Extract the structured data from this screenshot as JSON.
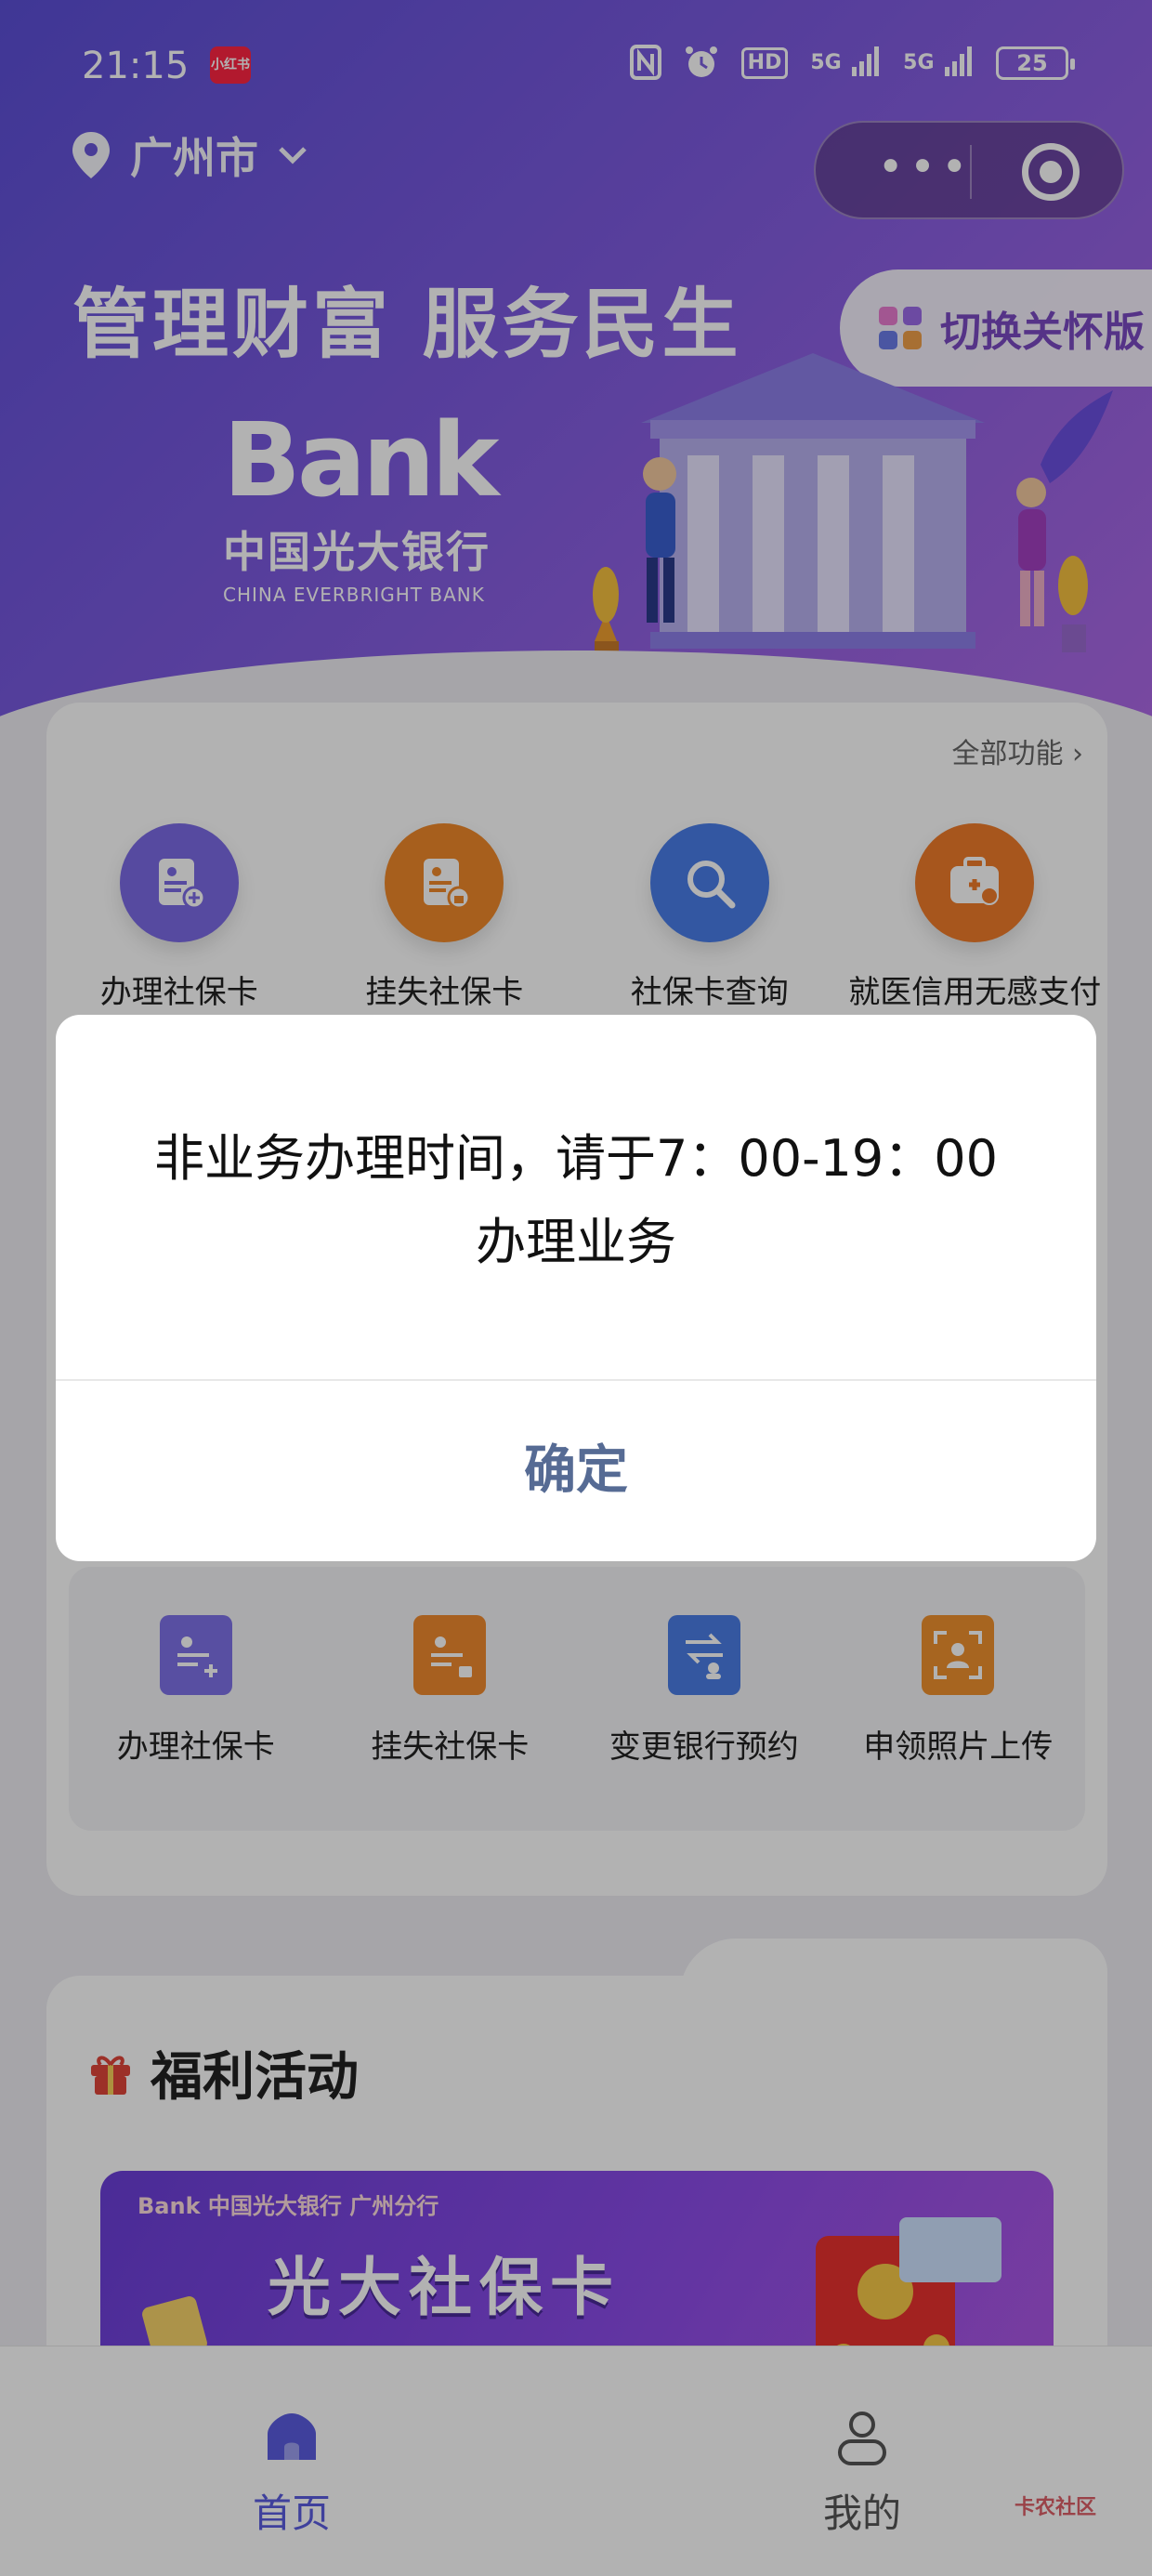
{
  "status_bar": {
    "time": "21:15",
    "app_badge": "小红书",
    "hd": "HD",
    "signal_1": "5G",
    "signal_2": "5G",
    "battery": "25"
  },
  "header": {
    "city": "广州市",
    "slogan": "管理财富 服务民生",
    "care_mode": "切换关怀版"
  },
  "logo": {
    "brand": "Bank",
    "cn": "中国光大银行",
    "en": "CHINA EVERBRIGHT BANK"
  },
  "services": {
    "all_functions": "全部功能",
    "items": [
      {
        "label": "办理社保卡",
        "color": "#7b6ae6"
      },
      {
        "label": "挂失社保卡",
        "color": "#f0892a"
      },
      {
        "label": "社保卡查询",
        "color": "#4a7de8"
      },
      {
        "label": "就医信用无感支付",
        "color": "#ef7b2a"
      }
    ],
    "sub_items": [
      {
        "label": "办理社保卡",
        "color": "#7f72e8"
      },
      {
        "label": "挂失社保卡",
        "color": "#f08a2e"
      },
      {
        "label": "变更银行预约",
        "color": "#4b7de6"
      },
      {
        "label": "申领照片上传",
        "color": "#f0912f"
      }
    ]
  },
  "welfare": {
    "title": "福利活动",
    "banner_brand": "Bank 中国光大银行 广州分行",
    "banner_title": "光大社保卡"
  },
  "tabbar": {
    "home": "首页",
    "mine": "我的"
  },
  "watermark": "卡农社区",
  "dialog": {
    "message": "非业务办理时间，请于7：00-19：00办理业务",
    "confirm": "确定"
  },
  "colors": {
    "accent": "#5b5ce0",
    "dialog_button": "#566b94"
  }
}
